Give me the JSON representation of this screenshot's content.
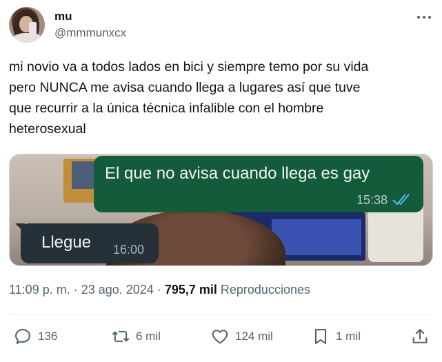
{
  "author": {
    "display_name": "mu",
    "handle": "@mmmunxcx"
  },
  "tweet": {
    "text": "mi novio va a todos lados en bici y siempre temo por su vida\npero NUNCA me avisa cuando llega a lugares así que tuve\nque recurrir a la única técnica infalible con el hombre\nheterosexual"
  },
  "media": {
    "outgoing_message": "El que no avisa cuando llega es gay",
    "outgoing_time": "15:38",
    "incoming_message": "Llegue",
    "incoming_time": "16:00",
    "bubble_out_color": "#145b3c",
    "bubble_in_color": "#253038",
    "read_ticks_color": "#53bdeb"
  },
  "meta": {
    "time": "11:09 p. m.",
    "separator": " · ",
    "date": "23 ago. 2024",
    "separator2": " · ",
    "views_count": "795,7 mil",
    "views_label": " Reproducciones"
  },
  "actions": {
    "reply_count": "136",
    "retweet_count": "6 mil",
    "like_count": "124 mil",
    "bookmark_count": "1 mil",
    "icons": [
      "reply-icon",
      "retweet-icon",
      "like-icon",
      "bookmark-icon",
      "share-icon"
    ]
  },
  "colors": {
    "text_primary": "#0f1419",
    "text_secondary": "#536471",
    "divider": "#eff3f4"
  }
}
